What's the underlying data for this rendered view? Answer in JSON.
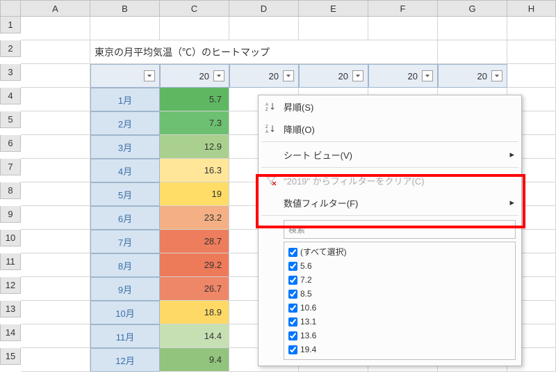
{
  "columns": [
    "A",
    "B",
    "C",
    "D",
    "E",
    "F",
    "G",
    "H"
  ],
  "rows": [
    "1",
    "2",
    "3",
    "4",
    "5",
    "6",
    "7",
    "8",
    "9",
    "10",
    "11",
    "12",
    "13",
    "14",
    "15"
  ],
  "title": "東京の月平均気温（℃）のヒートマップ",
  "header_vals": [
    "20",
    "20",
    "20",
    "20",
    "20"
  ],
  "months": [
    "1月",
    "2月",
    "3月",
    "4月",
    "5月",
    "6月",
    "7月",
    "8月",
    "9月",
    "10月",
    "11月",
    "12月"
  ],
  "values_c": [
    "5.7",
    "7.3",
    "12.9",
    "16.3",
    "19",
    "23.2",
    "28.7",
    "29.2",
    "26.7",
    "18.9",
    "14.4",
    "9.4"
  ],
  "colors_c": [
    "#5fb762",
    "#6dc071",
    "#a9d08e",
    "#ffe699",
    "#ffdd66",
    "#f4b084",
    "#ed7d5c",
    "#ed7a59",
    "#ee8668",
    "#ffd966",
    "#c6e0b4",
    "#92c47d"
  ],
  "menu": {
    "asc": "昇順(S)",
    "desc": "降順(O)",
    "sheet_view": "シート ビュー(V)",
    "clear_filter": "\"2019\" からフィルターをクリア(C)",
    "number_filter": "数値フィルター(F)",
    "search_placeholder": "検索",
    "select_all": "(すべて選択)",
    "options": [
      "5.6",
      "7.2",
      "8.5",
      "10.6",
      "13.1",
      "13.6",
      "19.4"
    ]
  },
  "chart_data": {
    "type": "heatmap",
    "title": "東京の月平均気温（℃）のヒートマップ",
    "categories": [
      "1月",
      "2月",
      "3月",
      "4月",
      "5月",
      "6月",
      "7月",
      "8月",
      "9月",
      "10月",
      "11月",
      "12月"
    ],
    "series": [
      {
        "name": "20",
        "values": [
          5.7,
          7.3,
          12.9,
          16.3,
          19,
          23.2,
          28.7,
          29.2,
          26.7,
          18.9,
          14.4,
          9.4
        ]
      }
    ],
    "xlabel": "",
    "ylabel": ""
  }
}
